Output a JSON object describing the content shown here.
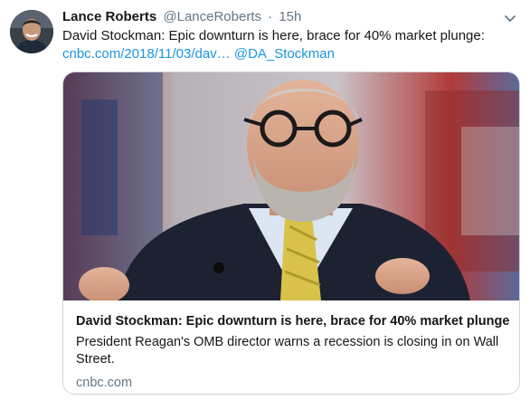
{
  "tweet": {
    "author_name": "Lance Roberts",
    "author_handle": "@LanceRoberts",
    "separator": "·",
    "time": "15h",
    "text": "David Stockman: Epic downturn is here, brace for 40% market plunge:",
    "link_text": "cnbc.com/2018/11/03/dav…",
    "mention": "@DA_Stockman"
  },
  "card": {
    "title": "David Stockman: Epic downturn is here, brace for 40% market plunge",
    "description": "President Reagan's OMB director warns a recession is closing in on Wall Street.",
    "domain": "cnbc.com"
  },
  "icons": {
    "caret": "chevron-down-icon"
  },
  "colors": {
    "link": "#1b95e0",
    "secondary_text": "#657786",
    "card_border": "#ccd6dd"
  }
}
